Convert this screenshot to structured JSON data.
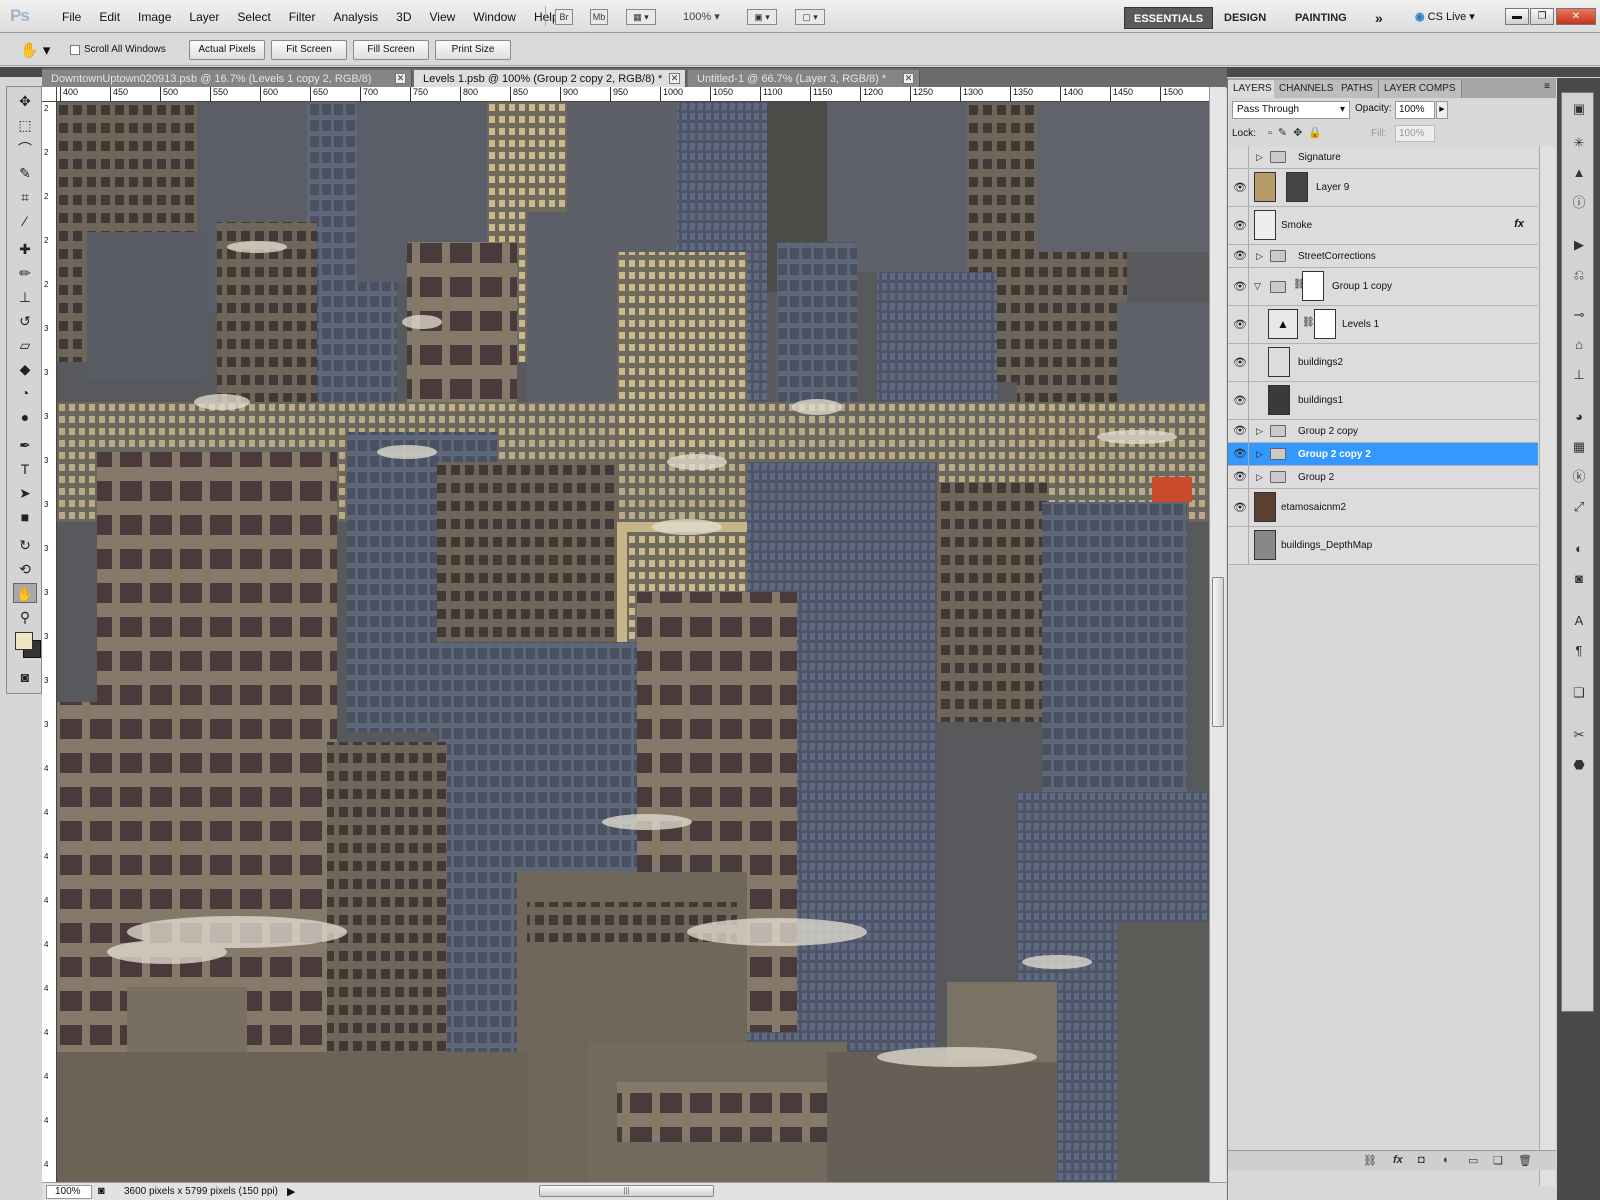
{
  "app": {
    "logo": "Ps"
  },
  "menu": [
    "File",
    "Edit",
    "Image",
    "Layer",
    "Select",
    "Filter",
    "Analysis",
    "3D",
    "View",
    "Window",
    "Help"
  ],
  "menubar": {
    "bridge": "Br",
    "minibridge": "Mb",
    "zoom": "100%",
    "workspaces": [
      "ESSENTIALS",
      "DESIGN",
      "PAINTING"
    ],
    "more": "»",
    "cslive": "CS Live"
  },
  "options": {
    "scroll_all": "Scroll All Windows",
    "buttons": [
      "Actual Pixels",
      "Fit Screen",
      "Fill Screen",
      "Print Size"
    ]
  },
  "tabs": [
    {
      "label": "DowntownUptown020913.psb @ 16.7% (Levels 1 copy 2, RGB/8)",
      "active": false
    },
    {
      "label": "Levels 1.psb @ 100% (Group 2 copy 2, RGB/8) *",
      "active": true
    },
    {
      "label": "Untitled-1 @ 66.7% (Layer 3, RGB/8) *",
      "active": false
    }
  ],
  "ruler": {
    "h": [
      "400",
      "450",
      "500",
      "550",
      "600",
      "650",
      "700",
      "750",
      "800",
      "850",
      "900",
      "950",
      "1000",
      "1050",
      "1100",
      "1150",
      "1200",
      "1250",
      "1300",
      "1350",
      "1400",
      "1450",
      "1500"
    ],
    "v": [
      "2",
      "2",
      "2",
      "2",
      "2",
      "3",
      "3",
      "3",
      "3",
      "3",
      "3",
      "3",
      "3",
      "3",
      "3",
      "4",
      "4",
      "4",
      "4",
      "4",
      "4",
      "4",
      "4",
      "4",
      "4"
    ]
  },
  "status": {
    "zoom": "100%",
    "info": "3600 pixels x 5799 pixels (150 ppi)"
  },
  "panel": {
    "tabs": [
      "LAYERS",
      "CHANNELS",
      "PATHS",
      "LAYER COMPS"
    ],
    "blend": "Pass Through",
    "opacity_label": "Opacity:",
    "opacity": "100%",
    "lock_label": "Lock:",
    "fill_label": "Fill:",
    "fill": "100%"
  },
  "layers": [
    {
      "name": "Signature",
      "type": "group",
      "visible": false
    },
    {
      "name": "Layer 9",
      "type": "layer",
      "visible": true
    },
    {
      "name": "Smoke",
      "type": "layer",
      "visible": true,
      "fx": "fx"
    },
    {
      "name": "StreetCorrections",
      "type": "group",
      "visible": true
    },
    {
      "name": "Group 1 copy",
      "type": "group",
      "visible": true,
      "expanded": true
    },
    {
      "name": "Levels 1",
      "type": "adjustment",
      "visible": true
    },
    {
      "name": "buildings2",
      "type": "smart",
      "visible": true
    },
    {
      "name": "buildings1",
      "type": "smart",
      "visible": true
    },
    {
      "name": "Group 2 copy",
      "type": "group",
      "visible": true
    },
    {
      "name": "Group 2 copy 2",
      "type": "group",
      "visible": true,
      "selected": true
    },
    {
      "name": "Group 2",
      "type": "group",
      "visible": true
    },
    {
      "name": "etamosaicnm2",
      "type": "smart",
      "visible": true
    },
    {
      "name": "buildings_DepthMap",
      "type": "smart",
      "visible": false
    }
  ]
}
